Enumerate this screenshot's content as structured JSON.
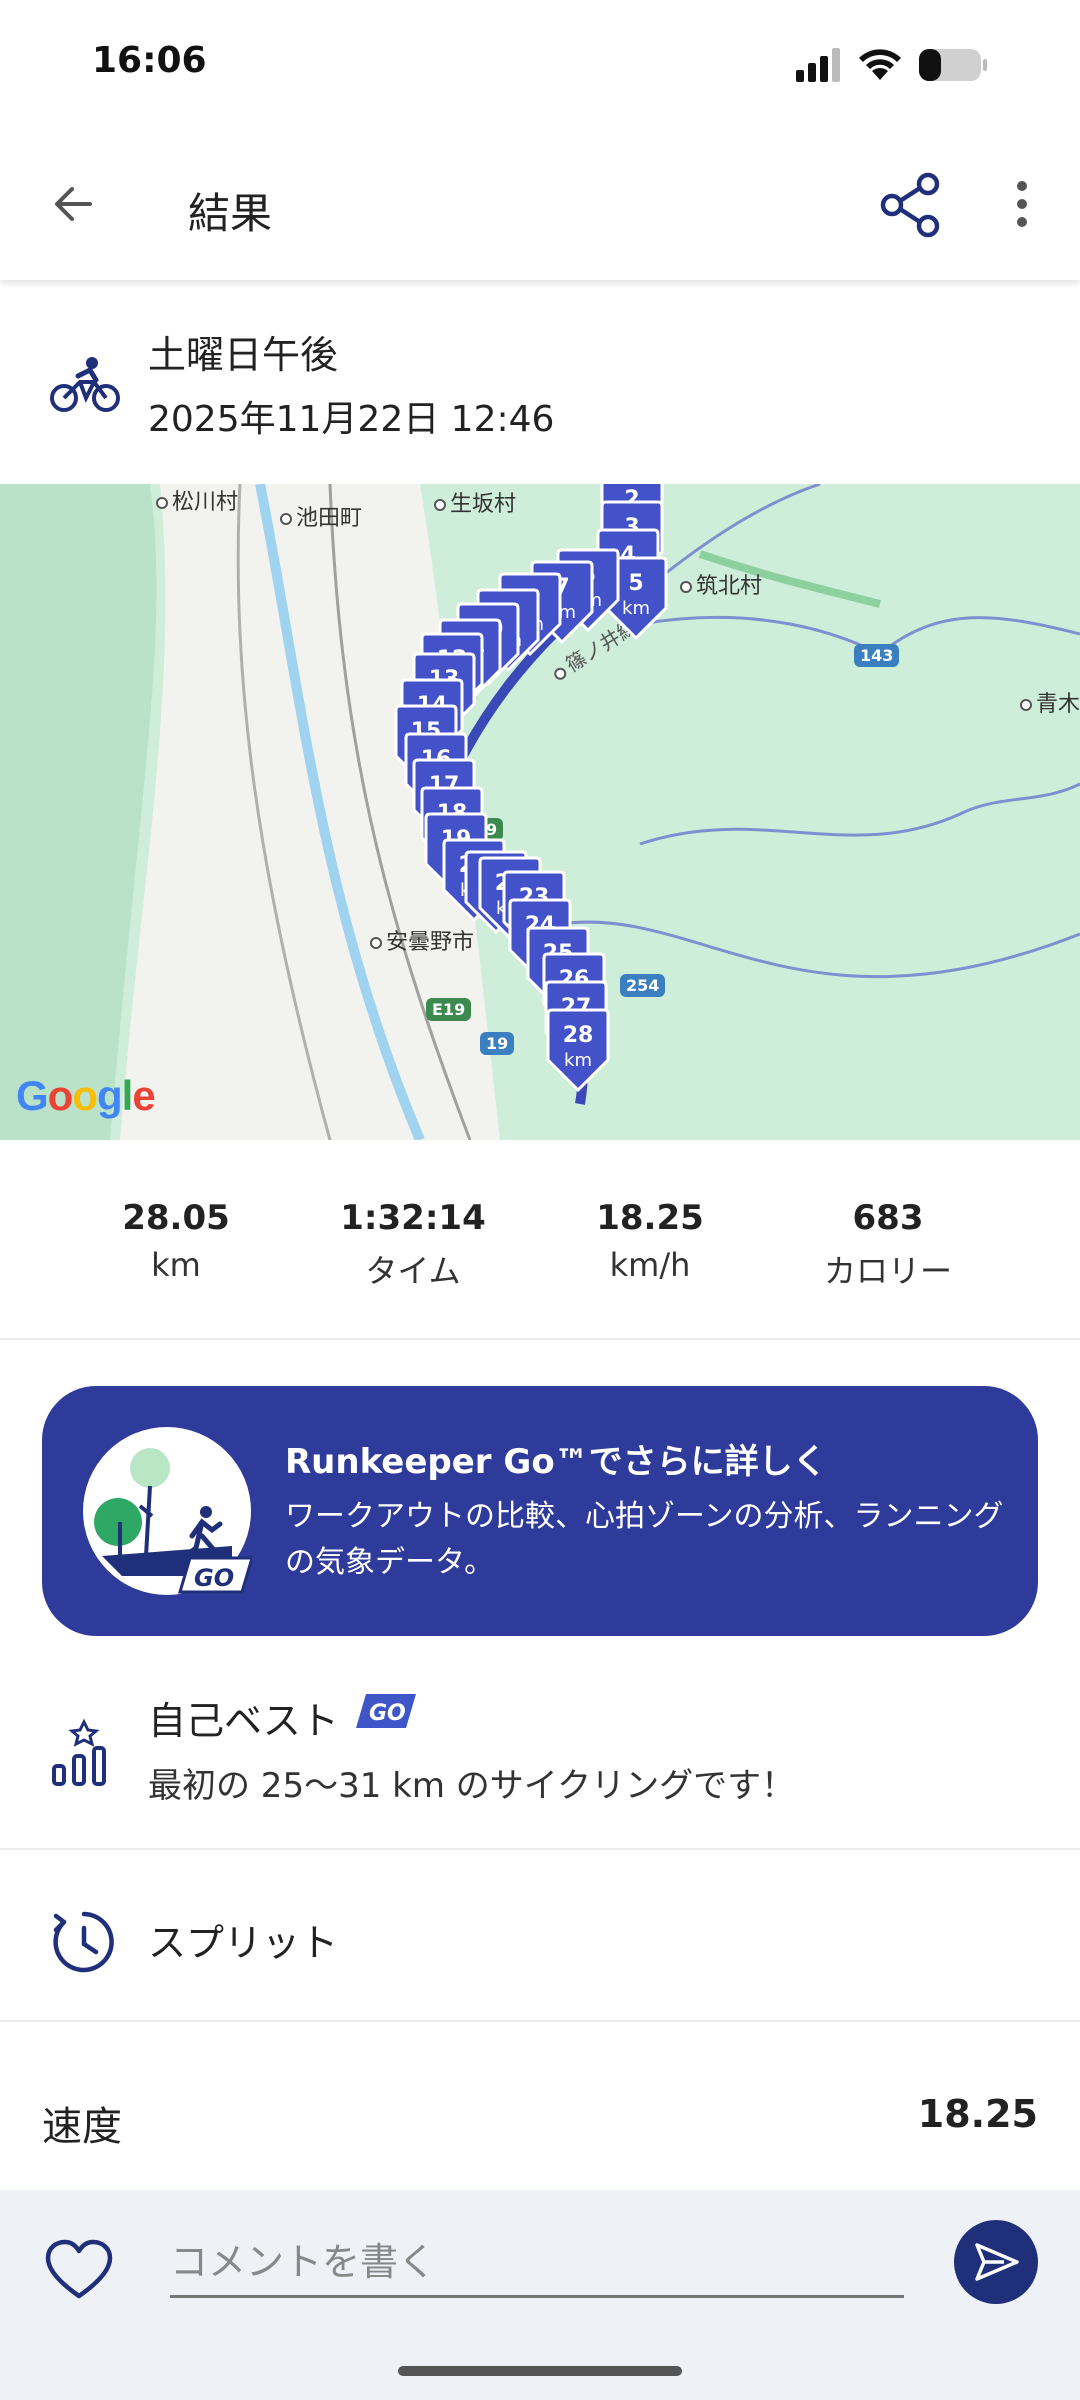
{
  "status_bar": {
    "time": "16:06"
  },
  "app_bar": {
    "title": "結果",
    "icons": [
      "back-arrow-icon",
      "share-icon",
      "more-vert-icon"
    ]
  },
  "activity": {
    "icon": "cycling-icon",
    "name": "土曜日午後",
    "datetime": "2025年11月22日 12:46"
  },
  "map": {
    "places": [
      "松川村",
      "池田町",
      "生坂村",
      "筑北村",
      "青木",
      "安曇野市"
    ],
    "road_badges": [
      "143",
      "254",
      "19",
      "E19",
      "9"
    ],
    "river_label": "篠ノ井線",
    "markers": [
      "2",
      "3",
      "4",
      "5",
      "6",
      "7",
      "8",
      "9",
      "10",
      "11",
      "12",
      "13",
      "14",
      "15",
      "16",
      "17",
      "18",
      "19",
      "20",
      "21",
      "22",
      "23",
      "24",
      "25",
      "26",
      "27",
      "28"
    ],
    "marker_unit": "km",
    "attribution": "Google",
    "colors": {
      "route": "#3a49b8",
      "marker": "#4452c9"
    }
  },
  "stats": [
    {
      "value": "28.05",
      "label": "km"
    },
    {
      "value": "1:32:14",
      "label": "タイム"
    },
    {
      "value": "18.25",
      "label": "km/h"
    },
    {
      "value": "683",
      "label": "カロリー"
    }
  ],
  "promo": {
    "title": "Runkeeper Go™でさらに詳しく",
    "body": "ワークアウトの比較、心拍ゾーンの分析、ランニングの気象データ。",
    "badge_text": "GO",
    "color": "#2e3b9a"
  },
  "personal_best": {
    "title": "自己ベスト",
    "tag": "GO",
    "description": "最初の 25〜31 km のサイクリングです！"
  },
  "splits": {
    "label": "スプリット"
  },
  "speed": {
    "label": "速度",
    "value": "18.25"
  },
  "comment_bar": {
    "placeholder": "コメントを書く"
  }
}
